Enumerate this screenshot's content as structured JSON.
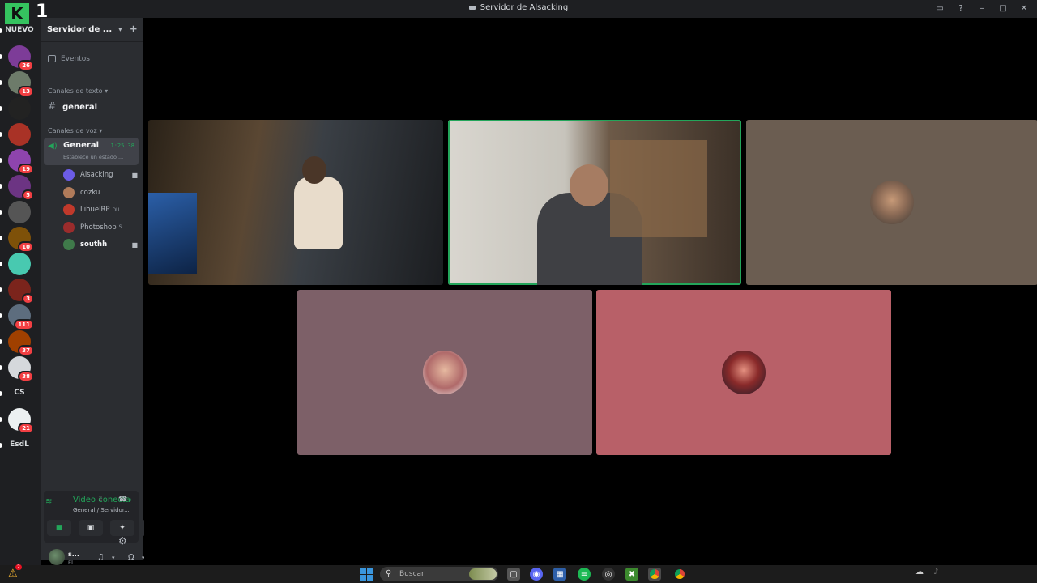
{
  "window": {
    "title": "Servidor de Alsacking"
  },
  "overlay": {
    "number": "1"
  },
  "guilds": [
    {
      "label": "NUEVO",
      "badge": ""
    },
    {
      "label": "",
      "badge": "26"
    },
    {
      "label": "",
      "badge": "13"
    },
    {
      "label": "",
      "badge": ""
    },
    {
      "label": "",
      "badge": ""
    },
    {
      "label": "",
      "badge": "19"
    },
    {
      "label": "",
      "badge": "5"
    },
    {
      "label": "",
      "badge": ""
    },
    {
      "label": "",
      "badge": "10"
    },
    {
      "label": "",
      "badge": ""
    },
    {
      "label": "",
      "badge": "3"
    },
    {
      "label": "",
      "badge": "111"
    },
    {
      "label": "",
      "badge": "37"
    },
    {
      "label": "",
      "badge": "38"
    },
    {
      "label": "CS",
      "badge": ""
    },
    {
      "label": "",
      "badge": "21"
    },
    {
      "label": "EsdL",
      "badge": ""
    }
  ],
  "sidebar": {
    "server_name": "Servidor de ...",
    "events": "Eventos",
    "text_category": "Canales de texto",
    "text_channel": "general",
    "voice_category": "Canales de voz",
    "voice_channel": {
      "name": "General",
      "time": "1:25:38",
      "status": "Establece un estado ..."
    },
    "voice_users": [
      {
        "name": "Alsacking",
        "extra": "",
        "camera": true,
        "bold": false
      },
      {
        "name": "cozku",
        "extra": "",
        "camera": false,
        "bold": false
      },
      {
        "name": "LihuelRP",
        "extra": "DU",
        "camera": false,
        "bold": false
      },
      {
        "name": "Photoshop",
        "extra": "S",
        "camera": false,
        "bold": false
      },
      {
        "name": "southh",
        "extra": "",
        "camera": true,
        "bold": true
      }
    ]
  },
  "voice_panel": {
    "title": "Video conectado",
    "subtitle": "General / Servidor..."
  },
  "user_panel": {
    "name": "s...",
    "status": "El"
  },
  "taskbar": {
    "warn_count": "2",
    "search_placeholder": "Buscar"
  },
  "colors": {
    "accent_green": "#23a55a",
    "tile_brown": "#6b5d51",
    "tile_mauve": "#7d6068",
    "tile_rose": "#b86068"
  }
}
